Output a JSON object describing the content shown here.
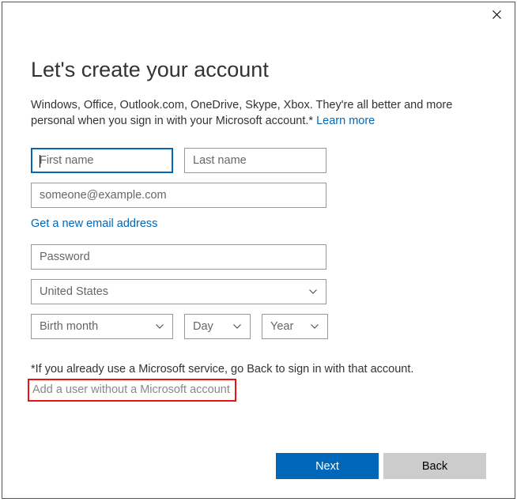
{
  "heading": "Let's create your account",
  "description_pre": "Windows, Office, Outlook.com, OneDrive, Skype, Xbox. They're all better and more personal when you sign in with your Microsoft account.* ",
  "learn_more": "Learn more",
  "fields": {
    "first_name_placeholder": "First name",
    "last_name_placeholder": "Last name",
    "email_placeholder": "someone@example.com",
    "password_placeholder": "Password",
    "country_value": "United States",
    "birth_month": "Birth month",
    "birth_day": "Day",
    "birth_year": "Year"
  },
  "new_email_link": "Get a new email address",
  "footnote": "*If you already use a Microsoft service, go Back to sign in with that account.",
  "alt_link": "Add a user without a Microsoft account",
  "buttons": {
    "next": "Next",
    "back": "Back"
  }
}
